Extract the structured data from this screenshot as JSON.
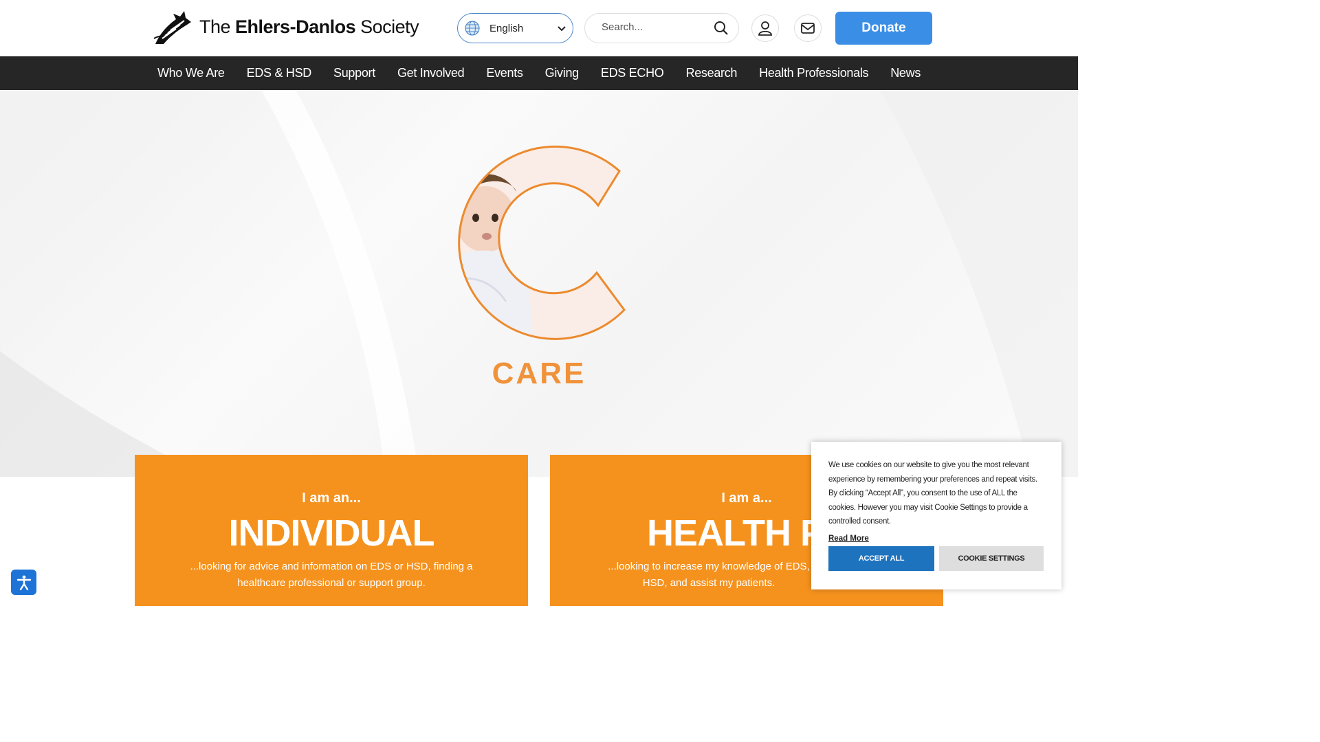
{
  "header": {
    "logo_prefix": "The ",
    "logo_bold": "Ehlers-Danlos",
    "logo_suffix": " Society",
    "language": "English",
    "search_placeholder": "Search...",
    "donate_label": "Donate"
  },
  "nav": {
    "items": [
      "Who We Are",
      "EDS & HSD",
      "Support",
      "Get Involved",
      "Events",
      "Giving",
      "EDS ECHO",
      "Research",
      "Health Professionals",
      "News"
    ]
  },
  "hero": {
    "word": "CARE",
    "accent": "#f0923a"
  },
  "cards": [
    {
      "pre": "I am an...",
      "title": "INDIVIDUAL",
      "desc": "...looking for advice and information on EDS or HSD, finding a healthcare professional or support group."
    },
    {
      "pre": "I am a...",
      "title": "HEALTH PR",
      "desc": "...looking to increase my knowledge of EDS, HSD, and assist my patients."
    }
  ],
  "cookie": {
    "text": "We use cookies on our website to give you the most relevant experience by remembering your preferences and repeat visits. By clicking “Accept All”, you consent to the use of ALL the cookies. However you may visit Cookie Settings to provide a controlled consent.",
    "read_more": "Read More",
    "accept_label": "ACCEPT ALL",
    "settings_label": "COOKIE SETTINGS"
  },
  "colors": {
    "nav_bg": "#262626",
    "donate": "#3b8ee6",
    "card_orange": "#f5921e",
    "cookie_accept": "#1e73be"
  },
  "icons": [
    "zebra-logo-icon",
    "globe-icon",
    "chevron-down-icon",
    "search-icon",
    "user-icon",
    "mail-icon",
    "accessibility-icon"
  ]
}
